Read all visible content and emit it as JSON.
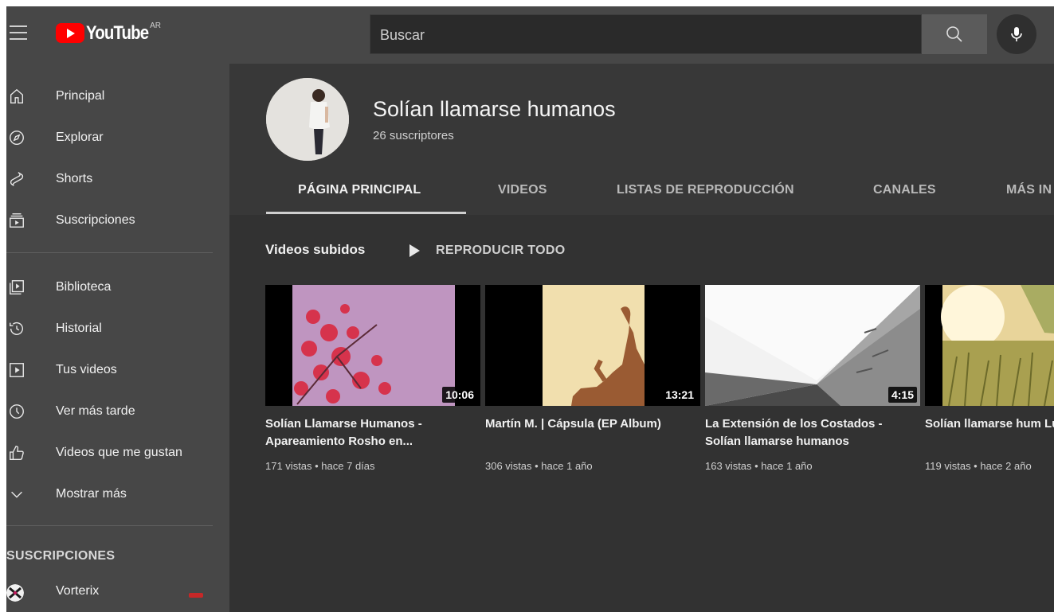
{
  "header": {
    "logo_text": "YouTube",
    "region": "AR",
    "search_placeholder": "Buscar"
  },
  "sidebar": {
    "primary": [
      {
        "label": "Principal",
        "icon": "home-icon"
      },
      {
        "label": "Explorar",
        "icon": "compass-icon"
      },
      {
        "label": "Shorts",
        "icon": "shorts-icon"
      },
      {
        "label": "Suscripciones",
        "icon": "subscriptions-icon"
      }
    ],
    "library": [
      {
        "label": "Biblioteca",
        "icon": "library-icon"
      },
      {
        "label": "Historial",
        "icon": "history-icon"
      },
      {
        "label": "Tus videos",
        "icon": "your-videos-icon"
      },
      {
        "label": "Ver más tarde",
        "icon": "watch-later-icon"
      },
      {
        "label": "Videos que me gustan",
        "icon": "thumbs-up-icon"
      },
      {
        "label": "Mostrar más",
        "icon": "chevron-down-icon"
      }
    ],
    "subscriptions_title": "SUSCRIPCIONES",
    "subscriptions": [
      {
        "label": "Vorterix",
        "live": true
      }
    ]
  },
  "channel": {
    "name": "Solían llamarse humanos",
    "subscribers": "26 suscriptores",
    "tabs": [
      "PÁGINA PRINCIPAL",
      "VIDEOS",
      "LISTAS DE REPRODUCCIÓN",
      "CANALES",
      "MÁS IN"
    ],
    "active_tab": 0
  },
  "shelf": {
    "title": "Videos subidos",
    "play_all": "REPRODUCIR TODO",
    "videos": [
      {
        "title": "Solían Llamarse Humanos - Apareamiento Rosho en...",
        "duration": "10:06",
        "meta": "171 vistas • hace 7 días"
      },
      {
        "title": "Martín M. | Cápsula (EP Album)",
        "duration": "13:21",
        "meta": "306 vistas • hace 1 año"
      },
      {
        "title": "La Extensión de los Costados - Solían llamarse humanos",
        "duration": "4:15",
        "meta": "163 vistas • hace 1 año"
      },
      {
        "title": "Solían llamarse hum Luz",
        "duration": "",
        "meta": "119 vistas • hace 2 año"
      }
    ]
  },
  "colors": {
    "brand_red": "#ff0000",
    "sidebar_bg": "#474747",
    "content_bg": "#323232"
  }
}
